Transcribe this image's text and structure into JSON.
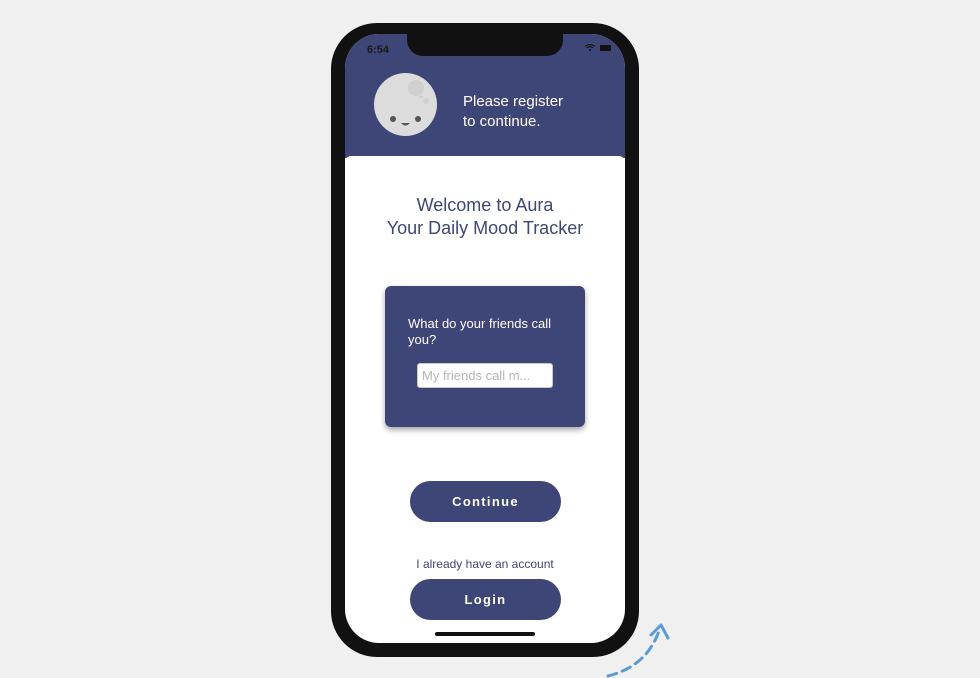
{
  "status_bar": {
    "time": "6:54",
    "icons": [
      "wifi-icon",
      "battery-icon"
    ]
  },
  "header": {
    "avatar_icon": "moon-face-icon",
    "line1": "Please register",
    "line2": "to continue."
  },
  "welcome": {
    "line1": "Welcome to Aura",
    "line2": "Your Daily Mood Tracker"
  },
  "name_card": {
    "question": "What do your friends call you?",
    "input_value": "",
    "input_placeholder": "My friends call m..."
  },
  "buttons": {
    "continue_label": "Continue",
    "login_label": "Login"
  },
  "account_prompt": "I already have an account",
  "colors": {
    "brand": "#3e4677",
    "background": "#f0f0f0",
    "arrow": "#5b9bd5"
  }
}
